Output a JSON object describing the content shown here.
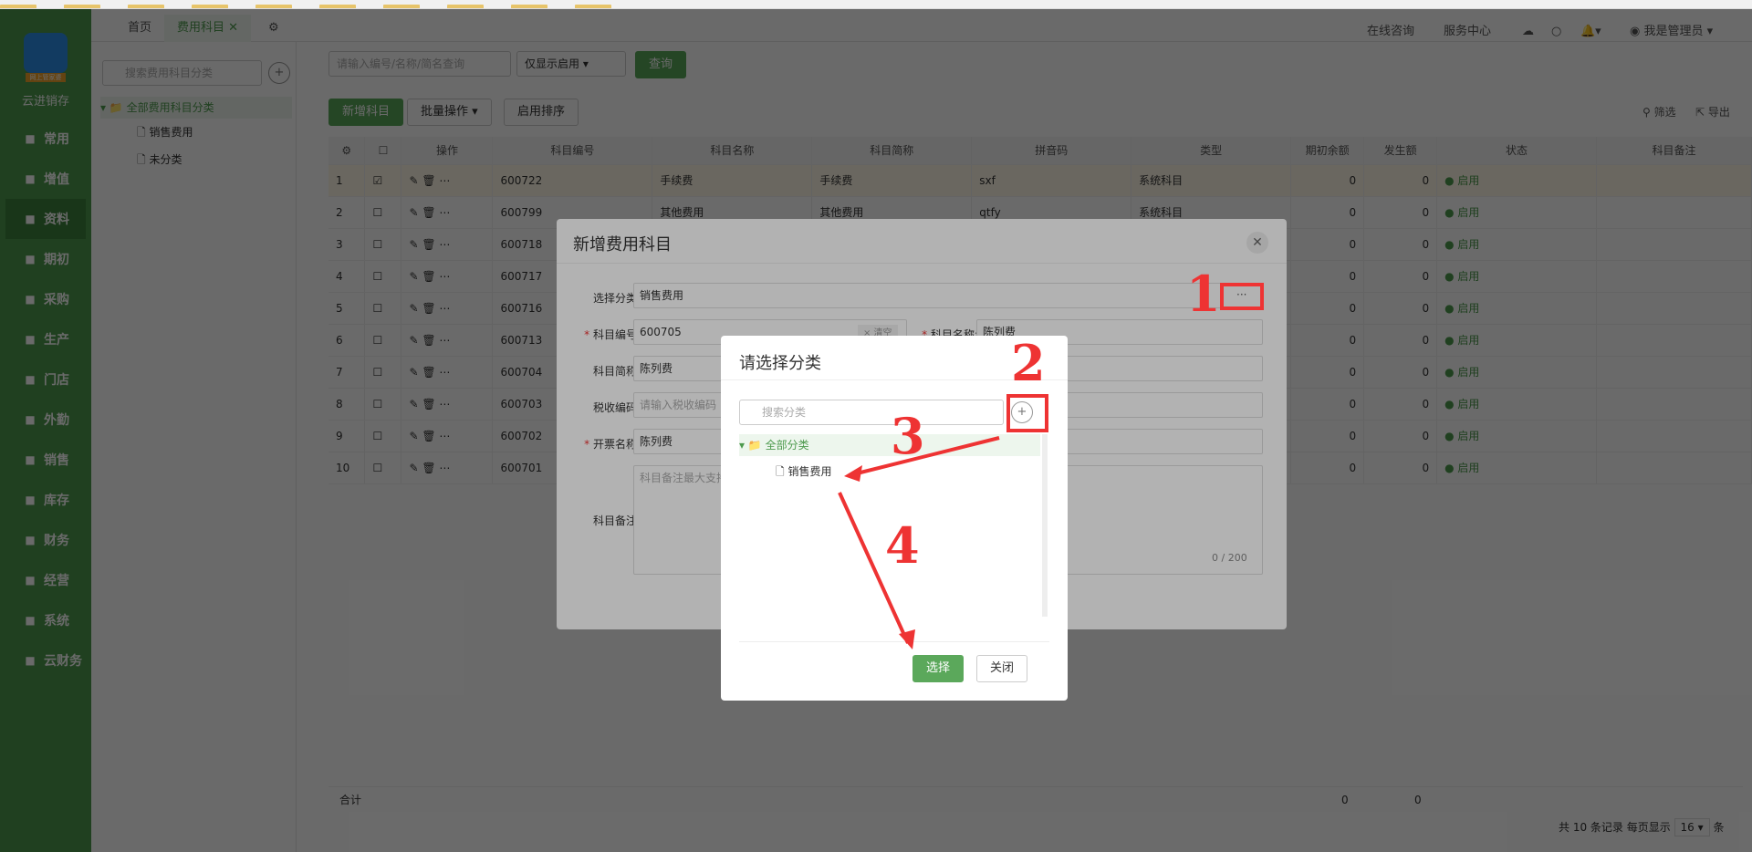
{
  "sidebar": {
    "brand": "云进销存",
    "logo_tag": "网上管家婆",
    "items": [
      "常用",
      "增值",
      "资料",
      "期初",
      "采购",
      "生产",
      "门店",
      "外勤",
      "销售",
      "库存",
      "财务",
      "经营",
      "系统",
      "云财务"
    ],
    "icons": [
      "star-icon",
      "plus-square-icon",
      "doc-icon",
      "clock-icon",
      "cart-icon",
      "factory-icon",
      "store-icon",
      "location-icon",
      "sales-icon",
      "warehouse-icon",
      "finance-icon",
      "chart-icon",
      "gear-icon",
      "cloud-finance-icon"
    ]
  },
  "tabs": {
    "home": "首页",
    "active": "费用科目"
  },
  "header": {
    "consult": "在线咨询",
    "service": "服务中心",
    "user": "我是管理员"
  },
  "tree": {
    "search_placeholder": "搜索费用科目分类",
    "root": "全部费用科目分类",
    "children": [
      "销售费用",
      "未分类"
    ]
  },
  "toolbar": {
    "search_placeholder": "请输入编号/名称/简名查询",
    "filter": "仅显示启用",
    "query": "查询",
    "add": "新增科目",
    "batch": "批量操作",
    "sort": "启用排序",
    "screen": "筛选",
    "export": "导出"
  },
  "table": {
    "headers": [
      "操作",
      "科目编号",
      "科目名称",
      "科目简称",
      "拼音码",
      "类型",
      "期初余额",
      "发生额",
      "状态",
      "科目备注"
    ],
    "rows": [
      {
        "no": "1",
        "code": "600722",
        "name": "手续费",
        "short": "手续费",
        "py": "sxf",
        "type": "系统科目",
        "init": "0",
        "amt": "0",
        "status": "● 启用"
      },
      {
        "no": "2",
        "code": "600799",
        "name": "其他费用",
        "short": "其他费用",
        "py": "qtfy",
        "type": "系统科目",
        "init": "0",
        "amt": "0",
        "status": "● 启用"
      },
      {
        "no": "3",
        "code": "600718",
        "name": "",
        "short": "",
        "py": "",
        "type": "",
        "init": "0",
        "amt": "0",
        "status": "● 启用"
      },
      {
        "no": "4",
        "code": "600717",
        "name": "",
        "short": "",
        "py": "",
        "type": "",
        "init": "0",
        "amt": "0",
        "status": "● 启用"
      },
      {
        "no": "5",
        "code": "600716",
        "name": "",
        "short": "",
        "py": "",
        "type": "",
        "init": "0",
        "amt": "0",
        "status": "● 启用"
      },
      {
        "no": "6",
        "code": "600713",
        "name": "",
        "short": "",
        "py": "",
        "type": "",
        "init": "0",
        "amt": "0",
        "status": "● 启用"
      },
      {
        "no": "7",
        "code": "600704",
        "name": "",
        "short": "",
        "py": "",
        "type": "",
        "init": "0",
        "amt": "0",
        "status": "● 启用"
      },
      {
        "no": "8",
        "code": "600703",
        "name": "",
        "short": "",
        "py": "",
        "type": "",
        "init": "0",
        "amt": "0",
        "status": "● 启用"
      },
      {
        "no": "9",
        "code": "600702",
        "name": "",
        "short": "",
        "py": "",
        "type": "",
        "init": "0",
        "amt": "0",
        "status": "● 启用"
      },
      {
        "no": "10",
        "code": "600701",
        "name": "",
        "short": "",
        "py": "",
        "type": "",
        "init": "0",
        "amt": "0",
        "status": "● 启用"
      }
    ],
    "total_label": "合计",
    "total_init": "0",
    "total_amt": "0",
    "footer": "共 10 条记录 每页显示",
    "page_size": "16",
    "page_unit": "条"
  },
  "dialog1": {
    "title": "新增费用科目",
    "cat_label": "选择分类:",
    "cat_value": "销售费用",
    "code_label": "科目编号:",
    "code_value": "600705",
    "code_btn": "× 清空",
    "name_label": "科目名称:",
    "name_value": "陈列费",
    "short_label": "科目简称:",
    "short_value": "陈列费",
    "tax_label": "税收编码:",
    "tax_placeholder": "请输入税收编码",
    "invoice_label": "开票名称:",
    "invoice_value": "陈列费",
    "remark_label": "科目备注:",
    "remark_placeholder": "科目备注最大支持",
    "counter": "0 / 200",
    "more": "···"
  },
  "dialog2": {
    "title": "请选择分类",
    "search_placeholder": "搜索分类",
    "root": "全部分类",
    "child": "销售费用",
    "select": "选择",
    "close": "关闭"
  },
  "annotations": [
    "1",
    "2",
    "3",
    "4"
  ]
}
